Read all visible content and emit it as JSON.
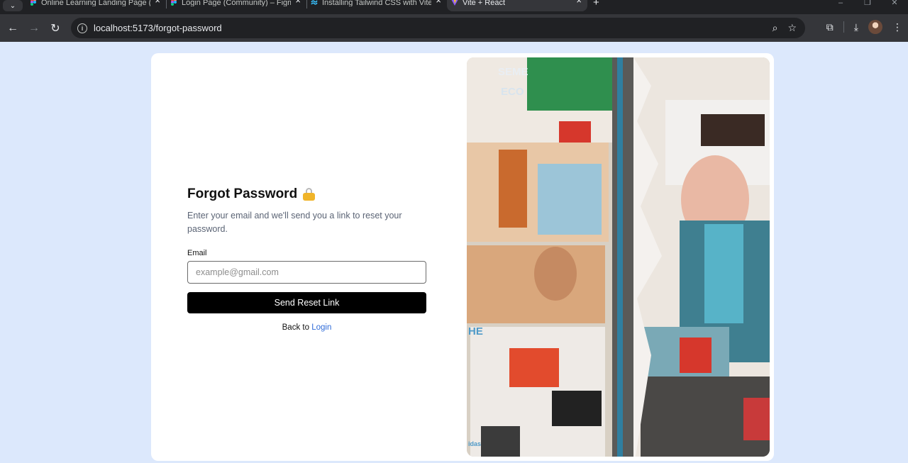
{
  "browser": {
    "tabs": [
      {
        "title": "Online Learning Landing Page (",
        "icon": "figma-icon",
        "active": false
      },
      {
        "title": "Login Page (Community) – Figm",
        "icon": "figma-icon",
        "active": false
      },
      {
        "title": "Installing Tailwind CSS with Vite",
        "icon": "tailwind-icon",
        "active": false
      },
      {
        "title": "Vite + React",
        "icon": "vite-icon",
        "active": true
      }
    ],
    "new_tab_symbol": "+",
    "url": "localhost:5173/forgot-password"
  },
  "page": {
    "heading": "Forgot Password",
    "heading_icon": "lock-icon",
    "subtitle": "Enter your email and we'll send you a link to reset your password.",
    "email_label": "Email",
    "email_placeholder": "example@gmail.com",
    "email_value": "",
    "submit_label": "Send Reset Link",
    "back_text": "Back to",
    "back_link": "Login",
    "link_color": "#2f6bd8",
    "button_color": "#000000",
    "background_color": "#dce8fc"
  },
  "collage": {
    "texts": [
      "SEME",
      "ECO",
      "HE",
      "idas"
    ]
  }
}
